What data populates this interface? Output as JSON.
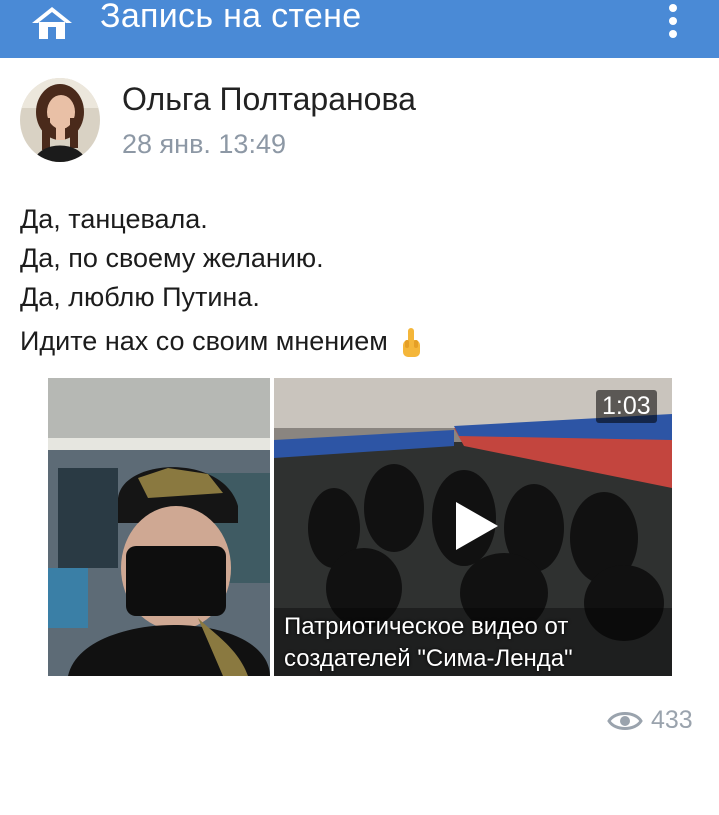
{
  "header": {
    "title": "Запись на стене",
    "home_icon": "home-icon",
    "menu_icon": "vertical-dots-icon",
    "background_color": "#4a8ad6"
  },
  "post": {
    "author": "Ольга Полтаранова",
    "date": "28 янв. 13:49",
    "text_lines": [
      "Да, танцевала.",
      "Да, по своему желанию.",
      "Да, люблю Путина.",
      "Идите нах со своим мнением"
    ],
    "emoji_icon": "middle-finger-icon",
    "attachments": {
      "photo": {
        "icon": "photo-thumbnail"
      },
      "video": {
        "duration": "1:03",
        "title_line1": "Патриотическое видео от",
        "title_line2": "создателей \"Сима-Ленда\"",
        "play_icon": "play-icon"
      }
    },
    "views": {
      "icon": "eye-icon",
      "count": "433"
    }
  }
}
